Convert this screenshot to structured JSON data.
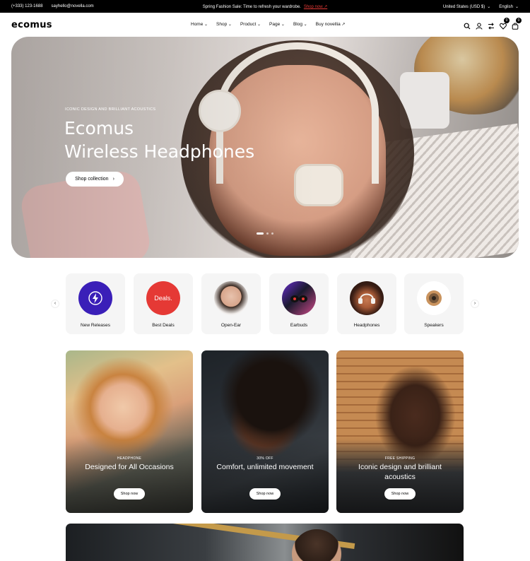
{
  "topbar": {
    "phone": "(+333) 123-1688",
    "email": "sayhello@novella.com",
    "promo_text": "Spring Fashion Sale: Time to refresh your wardrobe.",
    "promo_link": "Shop now ↗",
    "currency": "United States (USD $)",
    "language": "English"
  },
  "header": {
    "logo": "ecomus",
    "nav": [
      "Home",
      "Shop",
      "Product",
      "Page",
      "Blog",
      "Buy novellia"
    ],
    "wishlist_count": "0",
    "cart_count": "0"
  },
  "hero": {
    "eyebrow": "ICONIC DESIGN AND BRILLIANT ACOUSTICS",
    "title_line1": "Ecomus",
    "title_line2": "Wireless Headphones",
    "button": "Shop collection",
    "slides": 3,
    "active_slide": 1
  },
  "categories": [
    {
      "label": "New Releases",
      "icon": "lightning-icon",
      "color": "#3a1fb8"
    },
    {
      "label": "Best Deals",
      "icon_text": "Deals.",
      "color": "#e53935"
    },
    {
      "label": "Open-Ear",
      "icon": "open-ear-photo"
    },
    {
      "label": "Earbuds",
      "icon": "earbuds-photo"
    },
    {
      "label": "Headphones",
      "icon": "headphones-photo"
    },
    {
      "label": "Speakers",
      "icon": "speaker-photo"
    }
  ],
  "promos": [
    {
      "tag": "HEADPHONE",
      "title": "Designed for All Occasions",
      "button": "Shop now"
    },
    {
      "tag": "30% OFF",
      "title": "Comfort, unlimited movement",
      "button": "Shop now"
    },
    {
      "tag": "FREE SHIPPING",
      "title": "Iconic design and brilliant acoustics",
      "button": "Shop now"
    }
  ],
  "colors": {
    "topbar_bg": "#000000",
    "accent_link": "#e53935",
    "new_releases": "#3a1fb8",
    "best_deals": "#e53935"
  }
}
